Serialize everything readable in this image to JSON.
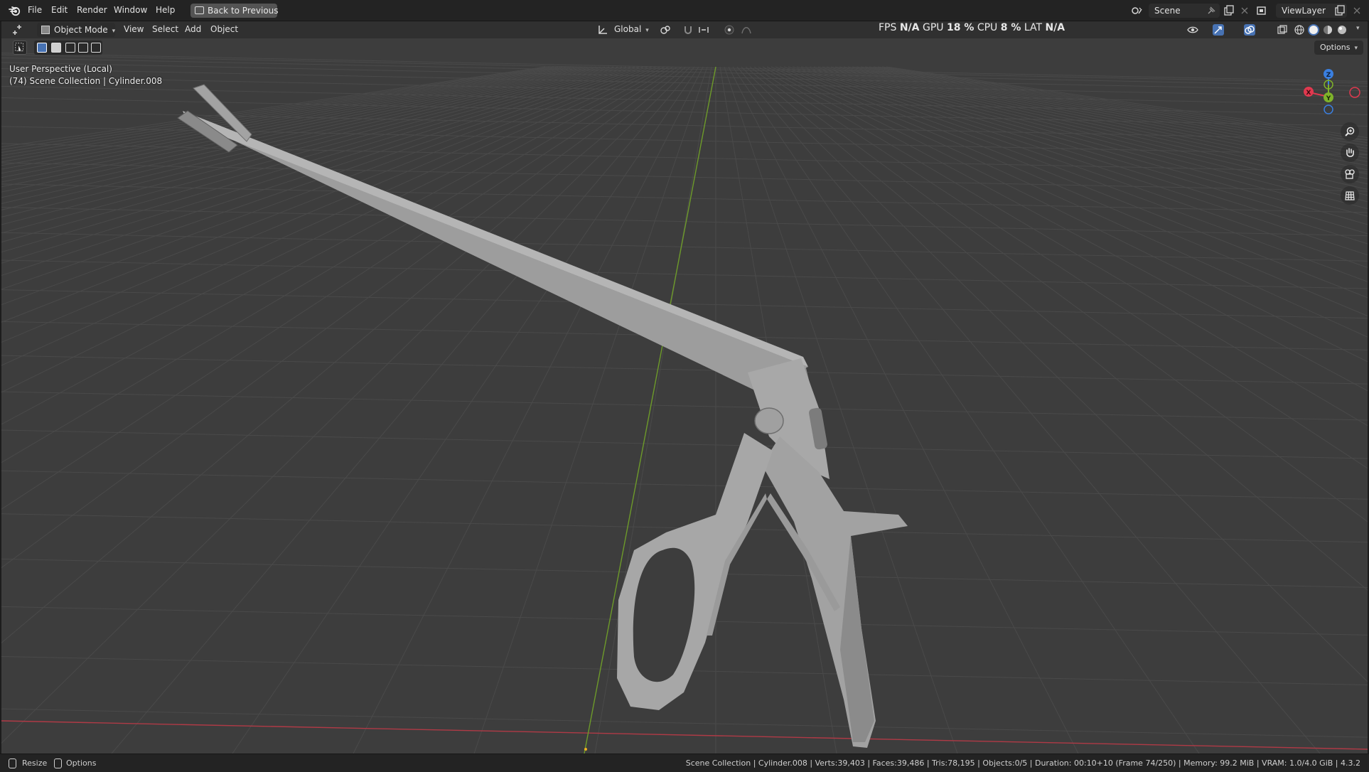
{
  "menu": {
    "file": "File",
    "edit": "Edit",
    "render": "Render",
    "window": "Window",
    "help": "Help",
    "back_to_previous": "Back to Previous"
  },
  "scene": {
    "label": "Scene"
  },
  "view_layer": {
    "label": "ViewLayer"
  },
  "header": {
    "mode": "Object Mode",
    "view": "View",
    "select": "Select",
    "add": "Add",
    "object": "Object",
    "orientation": "Global"
  },
  "perf": {
    "fps_label": "FPS",
    "fps_value": "N/A",
    "gpu_label": "GPU",
    "gpu_value": "18 %",
    "cpu_label": "CPU",
    "cpu_value": "8 %",
    "lat_label": "LAT",
    "lat_value": "N/A"
  },
  "viewport": {
    "perspective": "User Perspective (Local)",
    "collection": "(74) Scene Collection | Cylinder.008",
    "options": "Options",
    "gizmo": {
      "z": "Z",
      "y": "Y",
      "x": "X"
    },
    "colors": {
      "x_axis": "#e0394f",
      "y_axis": "#7fb32a",
      "z_axis": "#3a7fe0",
      "background": "#3d3d3d",
      "model": "#9a9a9a"
    }
  },
  "status": {
    "resize": "Resize",
    "options": "Options",
    "info": "Scene Collection | Cylinder.008 | Verts:39,403 | Faces:39,486 | Tris:78,195 | Objects:0/5 | Duration: 00:10+10 (Frame 74/250) | Memory: 99.2 MiB | VRAM: 1.0/4.0 GiB | 4.3.2"
  }
}
